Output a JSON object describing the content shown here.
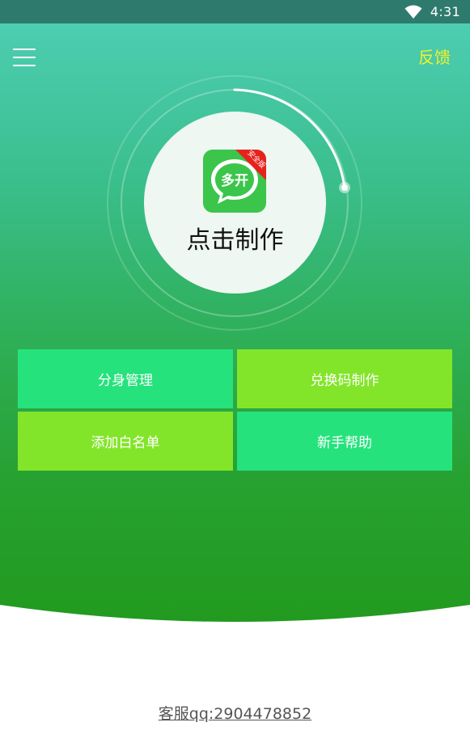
{
  "status_bar": {
    "time": "4:31",
    "wifi_icon": "wifi-icon"
  },
  "header": {
    "menu_icon": "hamburger-menu-icon",
    "feedback_label": "反馈"
  },
  "main": {
    "center_button": {
      "label": "点击制作",
      "icon": {
        "text": "多开",
        "badge": "安全版",
        "name": "multi-open-chat-icon"
      }
    },
    "tiles": [
      {
        "label": "分身管理",
        "color": "#26e27c"
      },
      {
        "label": "兑换码制作",
        "color": "#83e52a"
      },
      {
        "label": "添加白名单",
        "color": "#83e52a"
      },
      {
        "label": "新手帮助",
        "color": "#26e27c"
      }
    ]
  },
  "footer": {
    "service_text": "客服qq:2904478852"
  },
  "colors": {
    "status_bar": "#2e7b6d",
    "gradient_top": "#4dcdb2",
    "gradient_bottom": "#229a1e",
    "feedback": "#f2f228",
    "badge": "#e8211d",
    "icon_green": "#3cc54b"
  }
}
